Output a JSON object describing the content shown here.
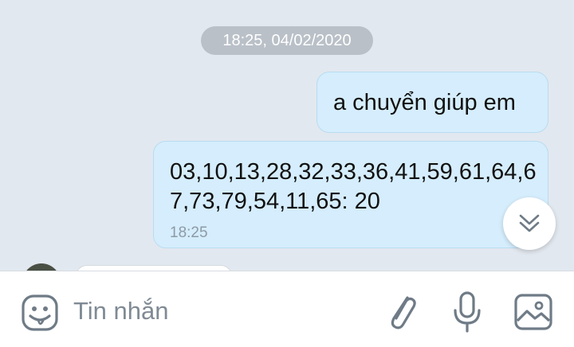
{
  "chat": {
    "date_separator": "18:25, 04/02/2020",
    "messages": [
      {
        "text": "a chuyển giúp em"
      },
      {
        "text": "03,10,13,28,32,33,36,41,59,61,64,67,73,79,54,11,65: 20",
        "time": "18:25"
      }
    ],
    "scroll_down_icon": "double-chevron-down-icon"
  },
  "composer": {
    "placeholder": "Tin nhắn",
    "icons": [
      "emoji-icon",
      "paperclip-icon",
      "microphone-icon",
      "image-icon"
    ]
  },
  "colors": {
    "chat_background": "#e2e8ef",
    "sent_bubble": "#d5edfc",
    "icon_gray": "#6f7b86"
  }
}
